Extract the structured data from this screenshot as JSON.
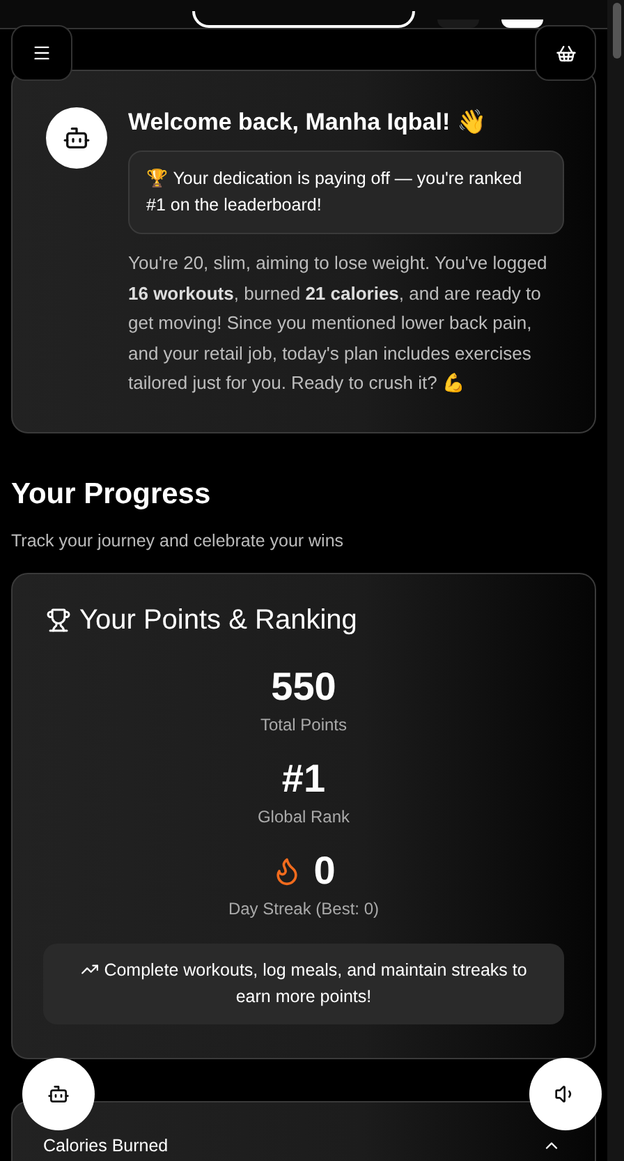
{
  "welcome": {
    "title": "Welcome back, Manha Iqbal! 👋",
    "achievement": "🏆 Your dedication is paying off — you're ranked #1 on the leaderboard!",
    "summary": "You're 20, slim, aiming to lose weight. You've logged **16 workouts**, burned **21 calories**, and are ready to get moving! Since you mentioned lower back pain, and your retail job, today's plan includes exercises tailored just for you. Ready to crush it? 💪"
  },
  "progress": {
    "title": "Your Progress",
    "subtitle": "Track your journey and celebrate your wins"
  },
  "points": {
    "title": "Your Points & Ranking",
    "stats": [
      {
        "kind": "plain",
        "value": "550",
        "label": "Total Points"
      },
      {
        "kind": "plain",
        "value": "#1",
        "label": "Global Rank"
      },
      {
        "kind": "streak",
        "value": "0",
        "label": "Day Streak (Best: 0)"
      }
    ],
    "tip": "Complete workouts, log meals, and maintain streaks to earn more points!"
  },
  "next_card": {
    "title": "Calories Burned",
    "expanded": true
  }
}
